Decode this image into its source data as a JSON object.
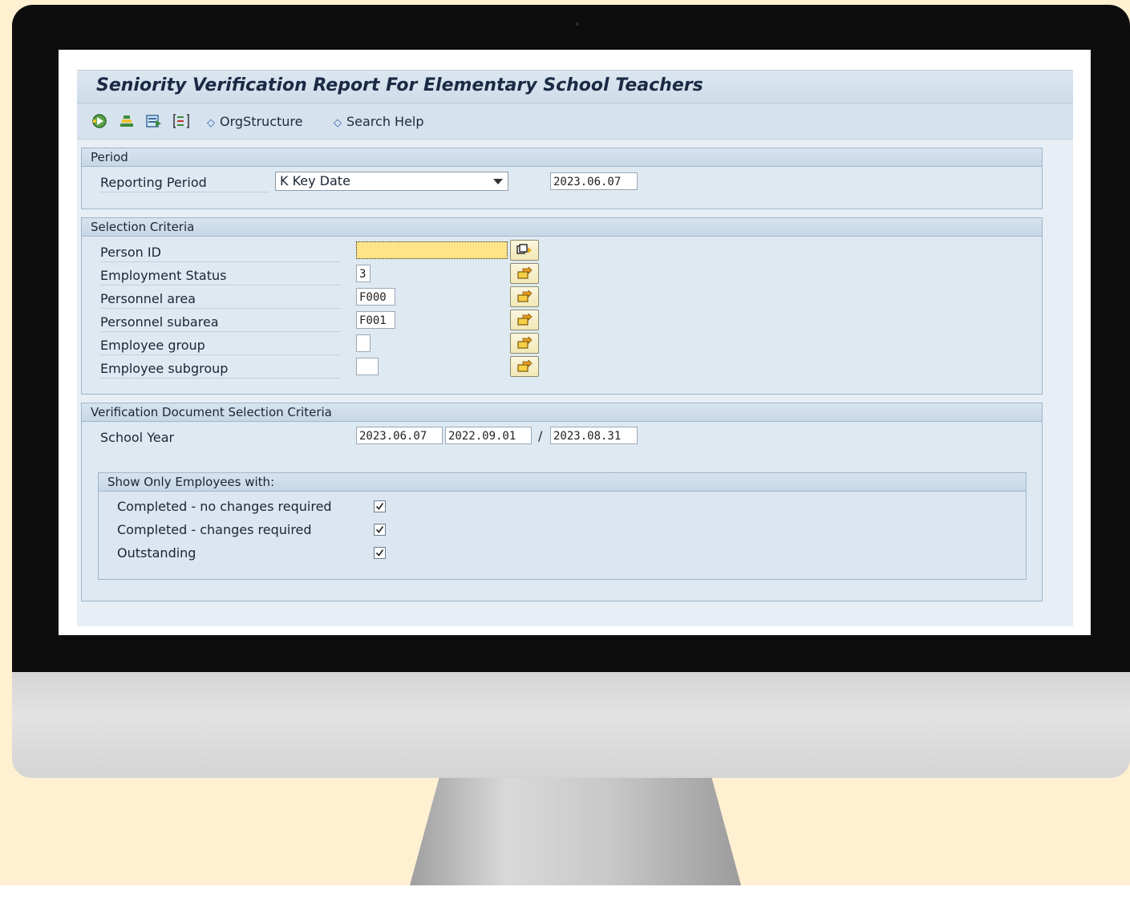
{
  "app": {
    "title": "Seniority Verification Report For Elementary School Teachers"
  },
  "toolbar": {
    "icons": [
      "execute-icon",
      "variants-icon",
      "get-variant-icon",
      "selection-options-icon"
    ],
    "links": [
      {
        "label": "OrgStructure"
      },
      {
        "label": "Search Help"
      }
    ]
  },
  "period": {
    "header": "Period",
    "reporting_period_label": "Reporting Period",
    "reporting_period_value": "K Key Date",
    "key_date": "2023.06.07"
  },
  "selection": {
    "header": "Selection Criteria",
    "rows": [
      {
        "label": "Person ID",
        "value": ""
      },
      {
        "label": "Employment Status",
        "value": "3"
      },
      {
        "label": "Personnel area",
        "value": "F000"
      },
      {
        "label": "Personnel subarea",
        "value": "F001"
      },
      {
        "label": "Employee group",
        "value": ""
      },
      {
        "label": "Employee subgroup",
        "value": ""
      }
    ]
  },
  "verification": {
    "header": "Verification Document Selection Criteria",
    "school_year_label": "School Year",
    "school_year_key": "2023.06.07",
    "school_year_from": "2022.09.01",
    "separator": "/",
    "school_year_to": "2023.08.31",
    "show_only": {
      "header": "Show Only Employees with:",
      "options": [
        {
          "label": "Completed - no changes required",
          "checked": true
        },
        {
          "label": "Completed - changes required",
          "checked": true
        },
        {
          "label": "Outstanding",
          "checked": true
        }
      ]
    }
  },
  "colors": {
    "required_field": "#fde488",
    "title_text": "#1a2a44",
    "group_border": "#9fb6ca"
  }
}
